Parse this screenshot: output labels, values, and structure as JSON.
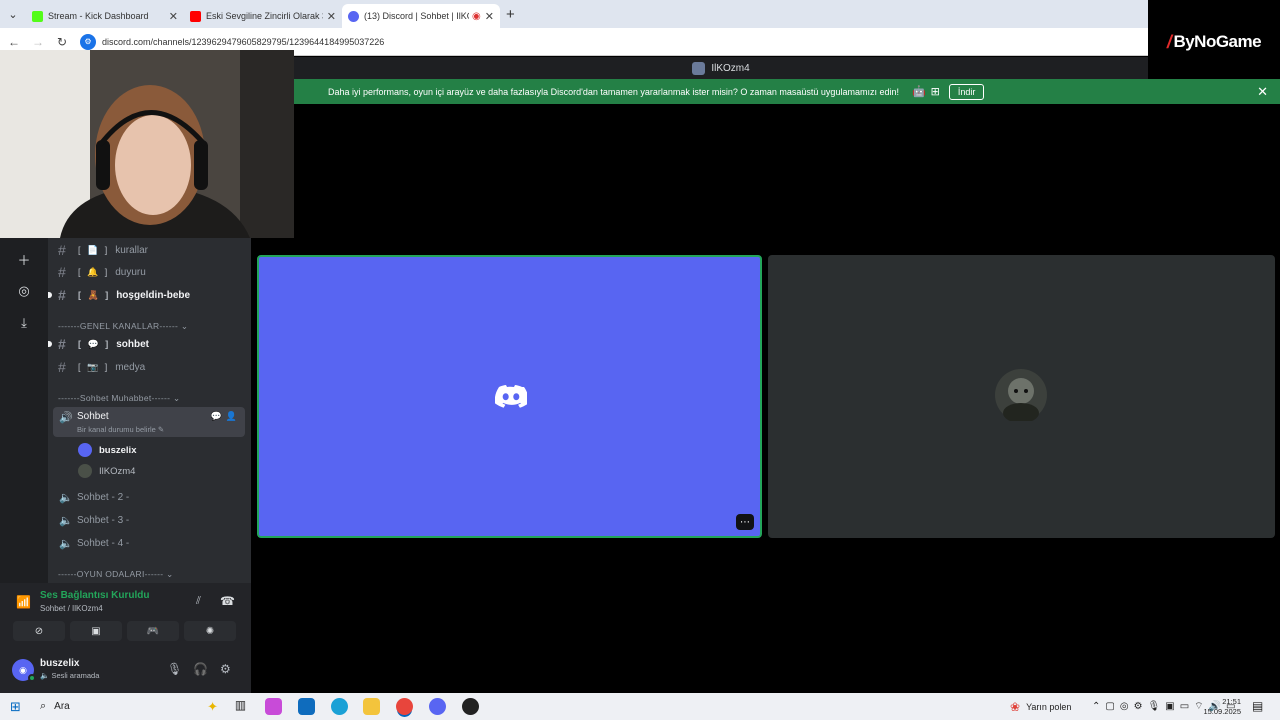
{
  "browser": {
    "tabs": [
      {
        "title": "Stream - Kick Dashboard",
        "active": false,
        "favicon_color": "#53fc18"
      },
      {
        "title": "Eski Sevgiline Zincirli Olarak 30",
        "active": false,
        "favicon_color": "#ff0000"
      },
      {
        "title": "(13) Discord | Sohbet | IlKOz..",
        "active": true,
        "favicon_color": "#5865f2"
      }
    ],
    "new_tab": "+",
    "url": "discord.com/channels/1239629479605829795/1239644184995037226"
  },
  "overlay_logo": "ByNoGame",
  "discord": {
    "window_title": "IlKOzm4",
    "banner": {
      "text": "Daha iyi performans, oyun içi arayüz ve daha fazlasıyla Discord'dan tamamen yararlanmak ister misin? O zaman masaüstü uygulamamızı edin!",
      "download_label": "İndir"
    },
    "channels": [
      {
        "name": "kurallar",
        "emoji": "[ 📄 ]"
      },
      {
        "name": "duyuru",
        "emoji": "[ 🔔 ]"
      },
      {
        "name": "hoşgeldin-bebe",
        "emoji": "[ 🧸 ]"
      },
      {
        "name": "sohbet",
        "emoji": "[ 💬 ]"
      },
      {
        "name": "medya",
        "emoji": "[ 📷 ]"
      }
    ],
    "categories": {
      "general": "-------GENEL KANALLAR------",
      "chat": "-------Sohbet Muhabbet------",
      "games": "------OYUN ODALARI------"
    },
    "voice_channels": [
      {
        "name": "Sohbet",
        "status": "Bir kanal durumu belirle"
      },
      {
        "name": "Sohbet - 2 -"
      },
      {
        "name": "Sohbet - 3 -"
      },
      {
        "name": "Sohbet - 4 -"
      }
    ],
    "voice_members": [
      {
        "name": "buszelix"
      },
      {
        "name": "IlKOzm4"
      }
    ],
    "voice_panel": {
      "status": "Ses Bağlantısı Kuruldu",
      "location": "Sohbet / IlKOzm4"
    },
    "user": {
      "name": "buszelix",
      "status": "Sesli aramada"
    }
  },
  "taskbar": {
    "search": "Ara",
    "weather": "Yarın polen",
    "time": "21:51",
    "date": "15.09.2025"
  },
  "colors": {
    "blurple": "#5865f2",
    "green": "#23a55a",
    "banner": "#248046"
  }
}
